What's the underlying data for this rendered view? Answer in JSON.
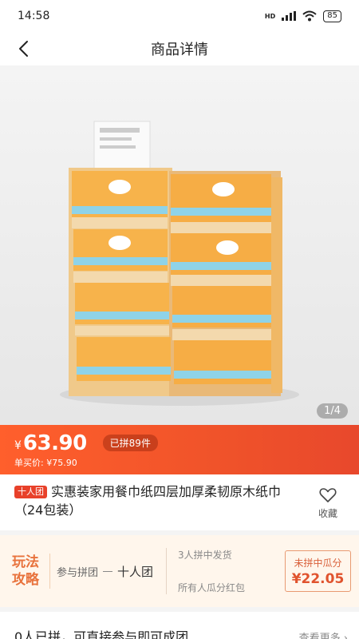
{
  "status_bar": {
    "time": "14:58",
    "battery": "85"
  },
  "header": {
    "title": "商品详情"
  },
  "gallery": {
    "pager": "1/4"
  },
  "price_bar": {
    "currency": "¥",
    "price": "63.90",
    "joined": "已拼89件",
    "unit_price": "单买价: ¥75.90"
  },
  "product": {
    "tag": "十人团",
    "title": "实惠装家用餐巾纸四层加厚柔韧原木纸巾（24包装）",
    "favorite_label": "收藏"
  },
  "strategy": {
    "title_line1": "玩法",
    "title_line2": "攻略",
    "join_label": "参与拼团",
    "group_type": "十人团",
    "rule1": "3人拼中发货",
    "rule2": "所有人瓜分红包",
    "reward_label": "未拼中瓜分",
    "reward_value": "¥22.05"
  },
  "bottom": {
    "left": "0人已拼，可直接参与即可成团",
    "right": "查看更多 ›"
  },
  "colors": {
    "accent": "#f0532a",
    "strategy_text": "#e8723c"
  }
}
